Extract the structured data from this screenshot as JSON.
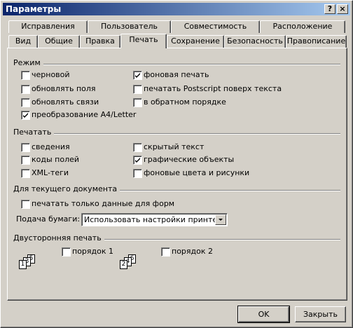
{
  "window": {
    "title": "Параметры",
    "help_glyph": "?",
    "close_glyph": "×"
  },
  "tabs_row1": [
    "Исправления",
    "Пользователь",
    "Совместимость",
    "Расположение"
  ],
  "tabs_row2": [
    "Вид",
    "Общие",
    "Правка",
    "Печать",
    "Сохранение",
    "Безопасность",
    "Правописание"
  ],
  "active_tab": "Печать",
  "sections": {
    "mode": {
      "title": "Режим",
      "options": [
        {
          "label": "черновой",
          "checked": false
        },
        {
          "label": "обновлять поля",
          "checked": false
        },
        {
          "label": "обновлять связи",
          "checked": false
        },
        {
          "label": "преобразование A4/Letter",
          "checked": true
        },
        {
          "label": "фоновая печать",
          "checked": true
        },
        {
          "label": "печатать Postscript поверх текста",
          "checked": false
        },
        {
          "label": "в обратном порядке",
          "checked": false
        }
      ]
    },
    "print": {
      "title": "Печатать",
      "options": [
        {
          "label": "сведения",
          "checked": false
        },
        {
          "label": "коды полей",
          "checked": false
        },
        {
          "label": "XML-теги",
          "checked": false
        },
        {
          "label": "скрытый текст",
          "checked": false
        },
        {
          "label": "графические объекты",
          "checked": true
        },
        {
          "label": "фоновые цвета и рисунки",
          "checked": false
        }
      ]
    },
    "current_doc": {
      "title": "Для текущего документа",
      "form_data_only": {
        "label": "печатать только данные для форм",
        "checked": false
      },
      "paper_feed_label": "Подача бумаги:",
      "paper_feed_value": "Использовать настройки принтера"
    },
    "duplex": {
      "title": "Двусторонняя печать",
      "order1": {
        "label": "порядок 1",
        "checked": false,
        "pages": [
          "1",
          "3",
          "5"
        ]
      },
      "order2": {
        "label": "порядок 2",
        "checked": false,
        "pages": [
          "2",
          "4",
          "6"
        ]
      }
    }
  },
  "buttons": {
    "ok": "OK",
    "close": "Закрыть"
  }
}
